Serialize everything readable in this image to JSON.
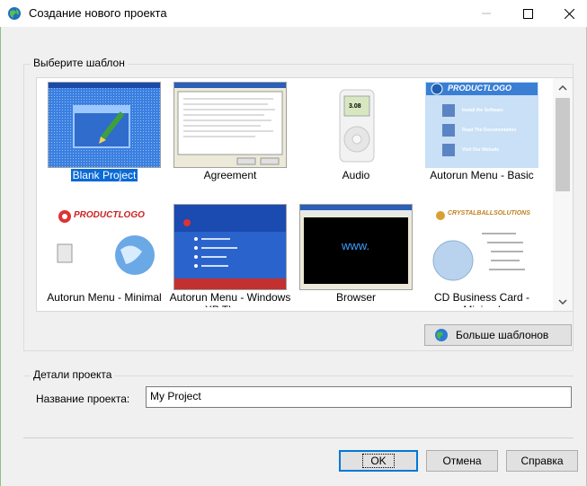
{
  "window": {
    "title": "Создание нового проекта"
  },
  "templates_group": {
    "label": "Выберите шаблон",
    "templates": [
      {
        "label": "Blank Project",
        "selected": true
      },
      {
        "label": "Agreement",
        "selected": false
      },
      {
        "label": "Audio",
        "selected": false
      },
      {
        "label": "Autorun Menu - Basic",
        "selected": false
      },
      {
        "label": "Autorun Menu - Minimal",
        "selected": false
      },
      {
        "label": "Autorun Menu - Windows XP Theme",
        "selected": false
      },
      {
        "label": "Browser",
        "selected": false
      },
      {
        "label": "CD Business Card - Minimal",
        "selected": false
      }
    ],
    "thumb_text": {
      "productlogo": "PRODUCTLOGO",
      "audio_time": "3.08",
      "browser_www": "www.",
      "crystal": "CRYSTALBALLSOLUTIONS",
      "basic_items": [
        "Install the Software",
        "Read The Documentation",
        "Visit Our Website"
      ]
    },
    "more_button": "Больше шаблонов"
  },
  "details_group": {
    "label": "Детали проекта",
    "name_label": "Название проекта:",
    "name_value": "My Project"
  },
  "buttons": {
    "ok": "OK",
    "cancel": "Отмена",
    "help": "Справка"
  },
  "colors": {
    "selection": "#0a6ad6",
    "default_button_border": "#0078d7"
  }
}
